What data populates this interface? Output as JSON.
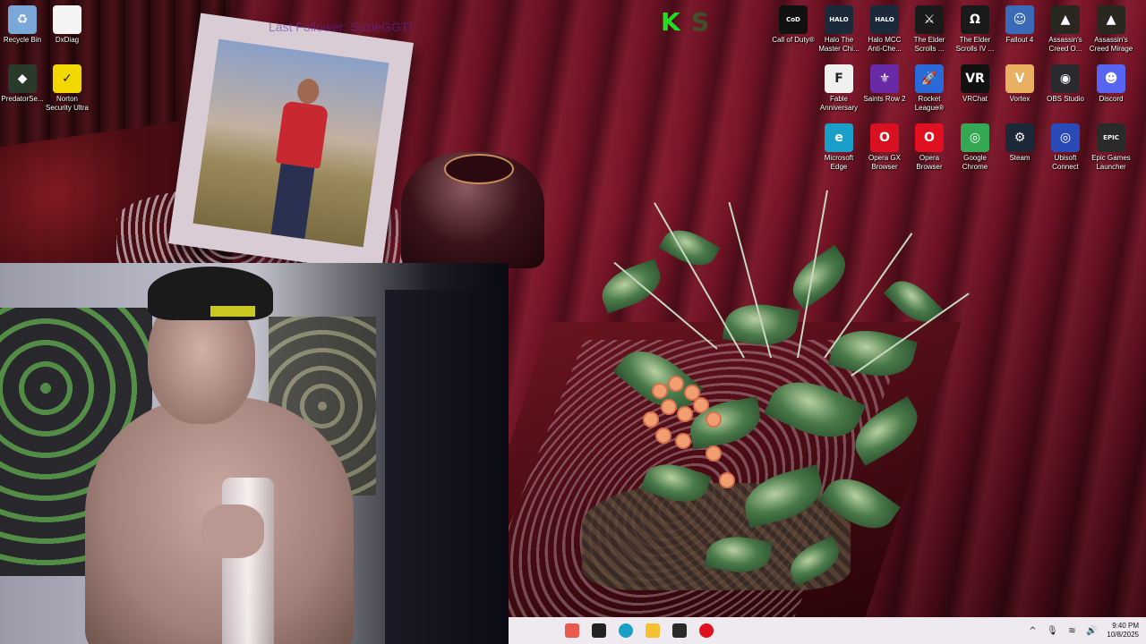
{
  "overlay": {
    "stream_text": "Last Follower: SuzieGGT!",
    "badge_left": "K",
    "badge_right": "S"
  },
  "desktop_icons": [
    {
      "label": "Recycle Bin",
      "icon": "recycle-bin-icon",
      "color": "#7aa8d8",
      "glyph": "♻"
    },
    {
      "label": "DxDiag",
      "icon": "document-icon",
      "color": "#f4f4f4",
      "glyph": ""
    },
    {
      "label": "PredatorSe...",
      "icon": "predator-sense-icon",
      "color": "#2a3a2a",
      "glyph": "◆"
    },
    {
      "label": "Norton Security Ultra",
      "icon": "norton-icon",
      "color": "#f2d800",
      "glyph": "✓"
    },
    {
      "label": "Call of Duty®",
      "icon": "call-of-duty-icon",
      "color": "#111111",
      "glyph": "CoD"
    },
    {
      "label": "Halo The Master Chi...",
      "icon": "halo-mcc-icon",
      "color": "#1a2a3a",
      "glyph": "HALO"
    },
    {
      "label": "Halo MCC Anti-Che...",
      "icon": "halo-anticheat-icon",
      "color": "#1a2a3a",
      "glyph": "HALO"
    },
    {
      "label": "The Elder Scrolls ...",
      "icon": "elder-scrolls-icon",
      "color": "#1a1a1a",
      "glyph": "⚔"
    },
    {
      "label": "The Elder Scrolls IV ...",
      "icon": "oblivion-icon",
      "color": "#1a1a1a",
      "glyph": "Ω"
    },
    {
      "label": "Fallout 4",
      "icon": "fallout-icon",
      "color": "#3a6ab8",
      "glyph": "☺"
    },
    {
      "label": "Assassin's Creed O...",
      "icon": "assassins-creed-odyssey-icon",
      "color": "#2a2620",
      "glyph": "▲"
    },
    {
      "label": "Assassin's Creed Mirage",
      "icon": "assassins-creed-mirage-icon",
      "color": "#2a2620",
      "glyph": "▲"
    },
    {
      "label": "Fable Anniversary",
      "icon": "fable-icon",
      "color": "#f0f0f0",
      "glyph": "F"
    },
    {
      "label": "Saints Row 2",
      "icon": "saints-row-icon",
      "color": "#6a2aa8",
      "glyph": "⚜"
    },
    {
      "label": "Rocket League®",
      "icon": "rocket-league-icon",
      "color": "#2a6ad8",
      "glyph": "🚀"
    },
    {
      "label": "VRChat",
      "icon": "vrchat-icon",
      "color": "#111111",
      "glyph": "VR"
    },
    {
      "label": "Vortex",
      "icon": "vortex-icon",
      "color": "#e8b060",
      "glyph": "V"
    },
    {
      "label": "OBS Studio",
      "icon": "obs-icon",
      "color": "#2a2a2e",
      "glyph": "◉"
    },
    {
      "label": "Discord",
      "icon": "discord-icon",
      "color": "#5865f2",
      "glyph": "☻"
    },
    {
      "label": "Microsoft Edge",
      "icon": "edge-icon",
      "color": "#1aa0c8",
      "glyph": "e"
    },
    {
      "label": "Opera GX Browser",
      "icon": "opera-gx-icon",
      "color": "#d81020",
      "glyph": "O"
    },
    {
      "label": "Opera Browser",
      "icon": "opera-icon",
      "color": "#e01020",
      "glyph": "O"
    },
    {
      "label": "Google Chrome",
      "icon": "chrome-icon",
      "color": "#34a853",
      "glyph": "◎"
    },
    {
      "label": "Steam",
      "icon": "steam-icon",
      "color": "#1b2838",
      "glyph": "⚙"
    },
    {
      "label": "Ubisoft Connect",
      "icon": "ubisoft-icon",
      "color": "#2a4ab8",
      "glyph": "◎"
    },
    {
      "label": "Epic Games Launcher",
      "icon": "epic-games-icon",
      "color": "#2a2a2a",
      "glyph": "EPIC"
    }
  ],
  "taskbar": {
    "pinned": [
      {
        "icon": "lobster-app-icon",
        "color": "#e85a4a"
      },
      {
        "icon": "terminal-icon",
        "color": "#222222"
      },
      {
        "icon": "edge-icon",
        "color": "#1aa0c8"
      },
      {
        "icon": "file-explorer-icon",
        "color": "#f2c030"
      },
      {
        "icon": "media-app-icon",
        "color": "#2a2a2a"
      },
      {
        "icon": "opera-icon",
        "color": "#e01020"
      }
    ],
    "tray": {
      "chevron": "^",
      "mic": "🎙",
      "wifi": "≋",
      "volume": "🔊"
    },
    "time": "9:40 PM",
    "date": "10/8/2025"
  }
}
